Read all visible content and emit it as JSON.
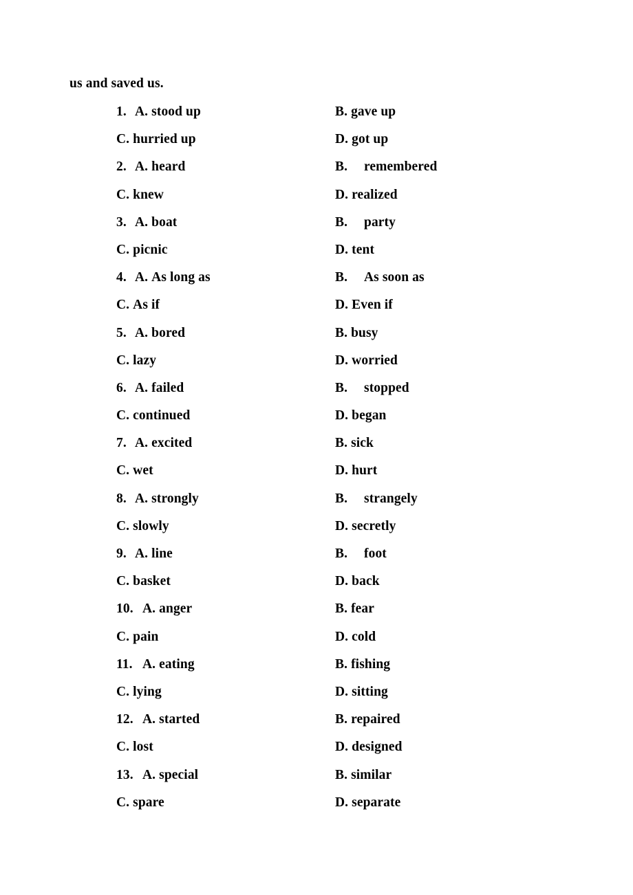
{
  "document": {
    "lead_line": "us and saved us.",
    "option_letters": {
      "a": "A.",
      "b": "B.",
      "c": "C.",
      "d": "D."
    },
    "questions": [
      {
        "number": "1.",
        "a": "stood up",
        "b": "gave up",
        "c": "hurried up",
        "d": "got up",
        "b_wide_gap": false
      },
      {
        "number": "2.",
        "a": "heard",
        "b": "remembered",
        "c": "knew",
        "d": "realized",
        "b_wide_gap": true
      },
      {
        "number": "3.",
        "a": "boat",
        "b": "party",
        "c": "picnic",
        "d": "tent",
        "b_wide_gap": true
      },
      {
        "number": "4.",
        "a": "As long as",
        "b": "As soon as",
        "c": "As if",
        "d": "Even if",
        "b_wide_gap": true
      },
      {
        "number": "5.",
        "a": "bored",
        "b": "busy",
        "c": "lazy",
        "d": "worried",
        "b_wide_gap": false
      },
      {
        "number": "6.",
        "a": "failed",
        "b": "stopped",
        "c": "continued",
        "d": "began",
        "b_wide_gap": true
      },
      {
        "number": "7.",
        "a": "excited",
        "b": "sick",
        "c": "wet",
        "d": "hurt",
        "b_wide_gap": false
      },
      {
        "number": "8.",
        "a": "strongly",
        "b": "strangely",
        "c": "slowly",
        "d": "secretly",
        "b_wide_gap": true
      },
      {
        "number": "9.",
        "a": "line",
        "b": "foot",
        "c": "basket",
        "d": "back",
        "b_wide_gap": true
      },
      {
        "number": "10.",
        "a": "anger",
        "b": "fear",
        "c": "pain",
        "d": "cold",
        "b_wide_gap": false
      },
      {
        "number": "11.",
        "a": "eating",
        "b": "fishing",
        "c": "lying",
        "d": "sitting",
        "b_wide_gap": false
      },
      {
        "number": "12.",
        "a": "started",
        "b": "repaired",
        "c": "lost",
        "d": "designed",
        "b_wide_gap": false
      },
      {
        "number": "13.",
        "a": "special",
        "b": "similar",
        "c": "spare",
        "d": "separate",
        "b_wide_gap": false
      }
    ]
  }
}
